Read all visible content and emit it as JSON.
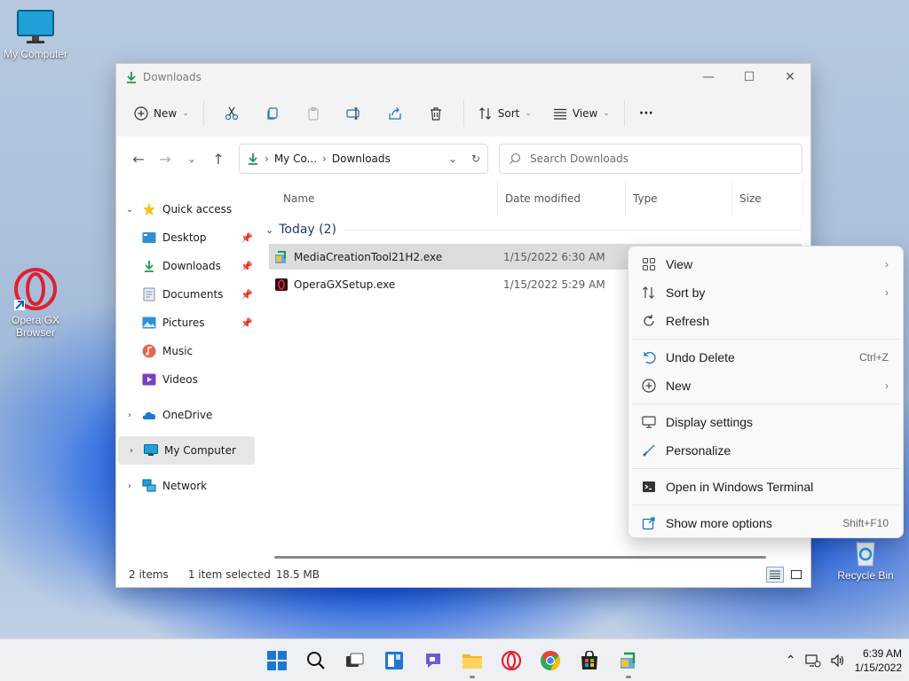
{
  "desktop": {
    "icons": [
      {
        "label": "My Computer"
      },
      {
        "label": "Opera GX Browser"
      },
      {
        "label": "Recycle Bin"
      }
    ]
  },
  "window": {
    "title": "Downloads",
    "toolbar": {
      "new_label": "New",
      "sort_label": "Sort",
      "view_label": "View",
      "more_label": "···"
    },
    "address": {
      "crumbs": [
        "My Co...",
        "Downloads"
      ]
    },
    "search": {
      "placeholder": "Search Downloads"
    },
    "sidebar": {
      "quick_access": "Quick access",
      "items": [
        {
          "label": "Desktop",
          "pinned": true
        },
        {
          "label": "Downloads",
          "pinned": true
        },
        {
          "label": "Documents",
          "pinned": true
        },
        {
          "label": "Pictures",
          "pinned": true
        },
        {
          "label": "Music",
          "pinned": false
        },
        {
          "label": "Videos",
          "pinned": false
        }
      ],
      "onedrive": "OneDrive",
      "my_computer": "My Computer",
      "network": "Network"
    },
    "columns": [
      "Name",
      "Date modified",
      "Type",
      "Size"
    ],
    "group_label": "Today (2)",
    "files": [
      {
        "name": "MediaCreationTool21H2.exe",
        "date": "1/15/2022 6:30 AM",
        "selected": true
      },
      {
        "name": "OperaGXSetup.exe",
        "date": "1/15/2022 5:29 AM",
        "selected": false
      }
    ],
    "status": {
      "count": "2 items",
      "selected": "1 item selected",
      "size": "18.5 MB"
    }
  },
  "context_menu": {
    "items": [
      {
        "label": "View",
        "icon": "grid-icon",
        "submenu": true
      },
      {
        "label": "Sort by",
        "icon": "sort-icon",
        "submenu": true
      },
      {
        "label": "Refresh",
        "icon": "refresh-icon"
      },
      {
        "label": "Undo Delete",
        "icon": "undo-icon",
        "shortcut": "Ctrl+Z"
      },
      {
        "label": "New",
        "icon": "plus-icon",
        "submenu": true
      },
      {
        "label": "Display settings",
        "icon": "display-icon"
      },
      {
        "label": "Personalize",
        "icon": "brush-icon"
      },
      {
        "label": "Open in Windows Terminal",
        "icon": "terminal-icon"
      },
      {
        "label": "Show more options",
        "icon": "share-icon",
        "shortcut": "Shift+F10"
      }
    ]
  },
  "taskbar": {
    "apps": [
      "start-icon",
      "search-icon",
      "task-view-icon",
      "widgets-icon",
      "chat-icon",
      "file-explorer-icon",
      "opera-gx-icon",
      "chrome-icon",
      "store-icon",
      "media-tool-icon"
    ],
    "clock_time": "6:39 AM",
    "clock_date": "1/15/2022"
  },
  "colors": {
    "accent": "#0a62c9",
    "download_green": "#1a9a4a",
    "opera_red": "#d4182e"
  }
}
